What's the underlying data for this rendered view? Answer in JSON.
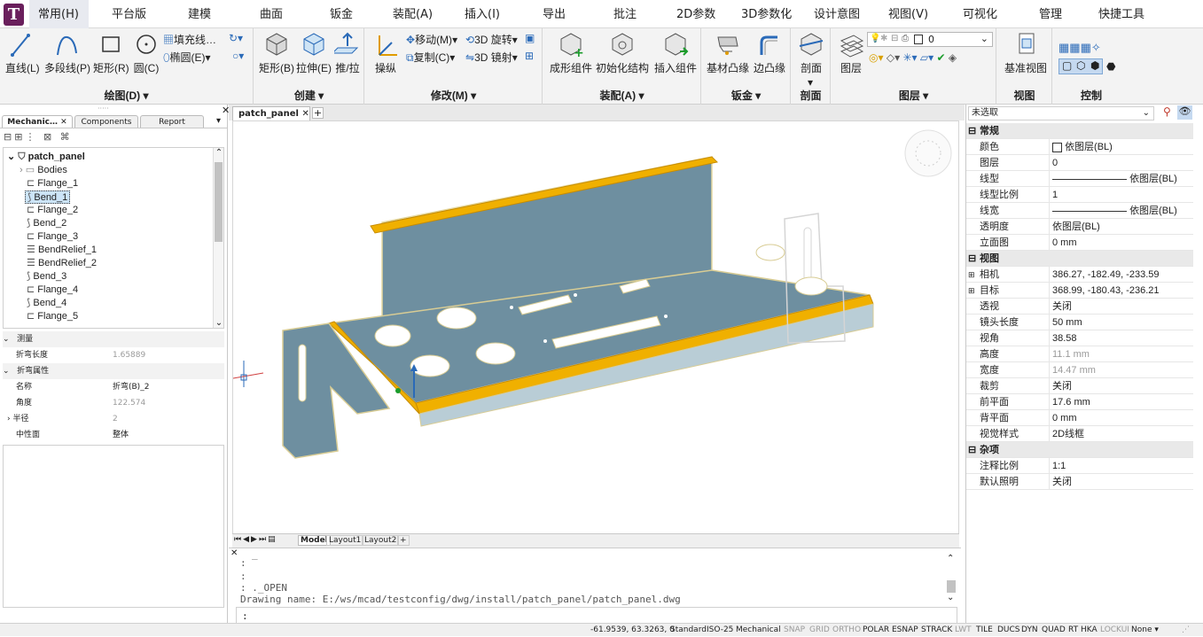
{
  "app_logo": "T",
  "menu": [
    "常用(H)",
    "平台版",
    "建模",
    "曲面",
    "钣金",
    "装配(A)",
    "插入(I)",
    "导出",
    "批注",
    "2D参数",
    "3D参数化",
    "设计意图",
    "视图(V)",
    "可视化",
    "管理",
    "快捷工具"
  ],
  "ribbon": {
    "draw": {
      "title": "绘图(D)",
      "line": "直线(L)",
      "polyline": "多段线(P)",
      "rect": "矩形(R)",
      "circle": "圆(C)",
      "hatch": "填充线…",
      "ellipse": "椭圆(E)"
    },
    "create": {
      "title": "创建",
      "rect": "矩形(B)",
      "extrude": "拉伸(E)",
      "pushpull": "推/拉"
    },
    "modify": {
      "title": "修改(M)",
      "manip": "操纵",
      "move": "移动(M)",
      "copy": "复制(C)",
      "rotate3d": "3D 旋转",
      "mirror3d": "3D 镜射"
    },
    "assembly": {
      "title": "装配(A)",
      "form": "成形组件",
      "init": "初始化结构",
      "insert": "插入组件"
    },
    "sheetmetal": {
      "title": "钣金",
      "base": "基材凸缘",
      "edge": "边凸缘"
    },
    "section": {
      "title": "剖面",
      "label": "剖面"
    },
    "layers": {
      "title": "图层",
      "label": "图层",
      "current": "0"
    },
    "view": {
      "title": "视图",
      "label": "基准视图"
    },
    "control": {
      "title": "控制"
    }
  },
  "left_tabs": [
    "Mechanic…",
    "Components",
    "Report"
  ],
  "tree": {
    "root": "patch_panel",
    "items": [
      "Bodies",
      "Flange_1",
      "Bend_1",
      "Flange_2",
      "Bend_2",
      "Flange_3",
      "BendRelief_1",
      "BendRelief_2",
      "Bend_3",
      "Flange_4",
      "Bend_4",
      "Flange_5"
    ]
  },
  "left_props": {
    "measure_hdr": "测量",
    "bend_length_label": "折弯长度",
    "bend_length_value": "1.65889",
    "bend_hdr": "折弯属性",
    "name_label": "名称",
    "name_value": "折弯(B)_2",
    "angle_label": "角度",
    "angle_value": "122.574",
    "radius_label": "半径",
    "radius_value": "2",
    "neutral_label": "中性面",
    "neutral_value": "整体"
  },
  "doc_tab": "patch_panel",
  "layout_tabs": [
    "Model",
    "Layout1",
    "Layout2"
  ],
  "cmdline": {
    "lines": [
      ":",
      ":",
      ": ._OPEN",
      "Drawing name: E:/ws/mcad/testconfig/dwg/install/patch_panel/patch_panel.dwg"
    ],
    "prompt": ":"
  },
  "right_panel": {
    "selection": "未选取",
    "sections": [
      {
        "name": "常规",
        "rows": [
          [
            "颜色",
            "依图层(BL)"
          ],
          [
            "图层",
            "0"
          ],
          [
            "线型",
            "依图层(BL)"
          ],
          [
            "线型比例",
            "1"
          ],
          [
            "线宽",
            "依图层(BL)"
          ],
          [
            "透明度",
            "依图层(BL)"
          ],
          [
            "立面图",
            "0 mm"
          ]
        ]
      },
      {
        "name": "视图",
        "rows": [
          [
            "相机",
            "386.27, -182.49, -233.59"
          ],
          [
            "目标",
            "368.99, -180.43, -236.21"
          ],
          [
            "透视",
            "关闭"
          ],
          [
            "镜头长度",
            "50 mm"
          ],
          [
            "视角",
            "38.58"
          ],
          [
            "高度",
            "11.1 mm"
          ],
          [
            "宽度",
            "14.47 mm"
          ],
          [
            "裁剪",
            "关闭"
          ],
          [
            "前平面",
            "17.6 mm"
          ],
          [
            "背平面",
            "0 mm"
          ],
          [
            "视觉样式",
            "2D线框"
          ]
        ]
      },
      {
        "name": "杂项",
        "rows": [
          [
            "注释比例",
            "1:1"
          ],
          [
            "默认照明",
            "关闭"
          ]
        ]
      }
    ]
  },
  "status": {
    "coords": "-61.9539, 63.3263, 0",
    "items": [
      "Standard",
      "ISO-25",
      "Mechanical",
      "SNAP",
      "GRID",
      "ORTHO",
      "POLAR",
      "ESNAP",
      "STRACK",
      "LWT",
      "TILE",
      "DUCS",
      "DYN",
      "QUAD",
      "RT",
      "HKA",
      "LOCKUI",
      "None"
    ]
  },
  "colors": {
    "accent": "#f0b000",
    "panel": "#6e8fa0",
    "logo": "#6a1f5c"
  }
}
